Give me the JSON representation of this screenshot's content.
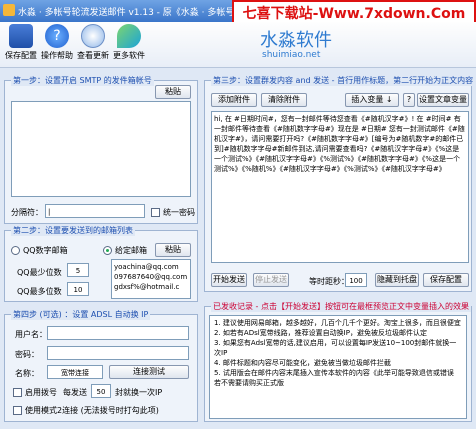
{
  "window": {
    "title": "水淼 · 多帐号轮流发送邮件 v1.13 - 原《水淼 · 多帐号轮流发送邮件》"
  },
  "banner": {
    "text": "七喜下载站-Www.7xdown.Com"
  },
  "toolbar": {
    "items": [
      {
        "label": "保存配置",
        "icon": "save-icon"
      },
      {
        "label": "操作帮助",
        "icon": "help-icon"
      },
      {
        "label": "查看更新",
        "icon": "update-icon"
      },
      {
        "label": "更多软件",
        "icon": "more-software-icon"
      }
    ]
  },
  "logo": {
    "name": "水淼软件",
    "url": "shuimiao.net"
  },
  "step1": {
    "title": "第一步：设置开启 SMTP 的发件箱帐号",
    "paste_label": "粘贴",
    "separator_label": "分隔符：",
    "separator_value": "|",
    "unified_password_label": "统一密码"
  },
  "step2": {
    "title": "第二步：设置要发送到的邮箱列表",
    "qq_radio_label": "QQ数字邮箱",
    "specified_radio_label": "给定邮箱",
    "paste_label": "粘贴",
    "qq_min_label": "QQ最少位数",
    "qq_min_value": "5",
    "qq_max_label": "QQ最多位数",
    "qq_max_value": "10",
    "recipients": "yoachina@qq.com\n097687640@qq.com\ngdxsf%@hotmail.c"
  },
  "step3": {
    "title": "第三步：设置群发内容 and 发送 - 首行用作标题，第二行开始为正文内容",
    "insert_attachment": "添加附件",
    "clear_attachment": "清除附件",
    "insert_variable": "插入变量 ↓",
    "help_mark": "?",
    "set_variable": "设置文章变量",
    "content": "hi, 在 #日期时间#，您有一封邮件等待您查看《#随机汉字#》! 在 #时间# 有一封邮件等待查看《#随机数字字母#》现在是 #日期# 您有一封测试邮件《#随机汉字#》，请问需要打开吗?《#随机数字字母#》[编号为#随机数字#的邮件已到]#随机数字字母#新邮件到达,请问需要查看吗?《#随机汉字字母#》《%这是一个测试%》《#随机汉字字母#》《%测试%》《#随机数字字母#》《%这是一个测试%》《%随机%》《#随机汉字字母#》《%测试%》《#随机汉字字母#》",
    "start_send": "开始发送",
    "stop_send": "停止发送",
    "interval_label": "等时距秒：",
    "interval_value": "100",
    "hide_tray": "隐藏到托盘",
    "save_config": "保存配置"
  },
  "step4": {
    "title": "第四步 (可选) ：设置 ADSL 自动换 IP",
    "username_label": "用户名：",
    "password_label": "密码：",
    "dialup_label": "名称：",
    "dialup_value": "宽带连接",
    "test_connect": "连接测试",
    "enable_label": "启用拨号",
    "send_label": "每发送",
    "send_count": "50",
    "switch_label": "封就换一次IP",
    "mode2_label": "使用模式2连接 (无法拨号时打勾此项)"
  },
  "log": {
    "title": "已发收记录 - 点击【开始发送】按钮可在最框预览正文中变量插入的效果",
    "lines": [
      "1. 建议使用网易邮箱，越多越好，几百个几千个更好。淘宝上很多，而且很便宜",
      "2. 如若有ADsl宽带线路，推荐设置自动换IP，避免被反垃圾邮件认定",
      "3. 如果您有Adsl宽带的话,建议启用，可以设置每IP发送10~100封邮件就换一次IP",
      "4. 邮件标题和内容尽可能变化，避免被当做垃圾邮件拦截",
      "5. 试用版会在邮件内容末尾插入宣传本软件的内容《此举可能导致退信或错误 若不需要请购买正式版"
    ]
  }
}
